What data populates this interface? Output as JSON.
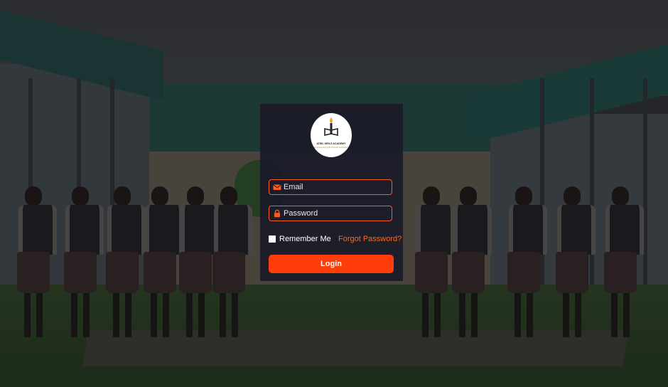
{
  "school": {
    "name": "ATIEL GIRLS ACADEMY",
    "motto": "Empowering girls through education"
  },
  "form": {
    "email_placeholder": "Email",
    "password_placeholder": "Password",
    "remember_label": "Remember Me",
    "forgot_label": "Forgot Password?",
    "login_label": "Login"
  },
  "icons": {
    "email": "envelope-icon",
    "password": "lock-icon"
  },
  "colors": {
    "accent": "#ff5a1f",
    "button": "#ff3d0b",
    "card": "#1a1b28",
    "link": "#ff6a1a"
  }
}
